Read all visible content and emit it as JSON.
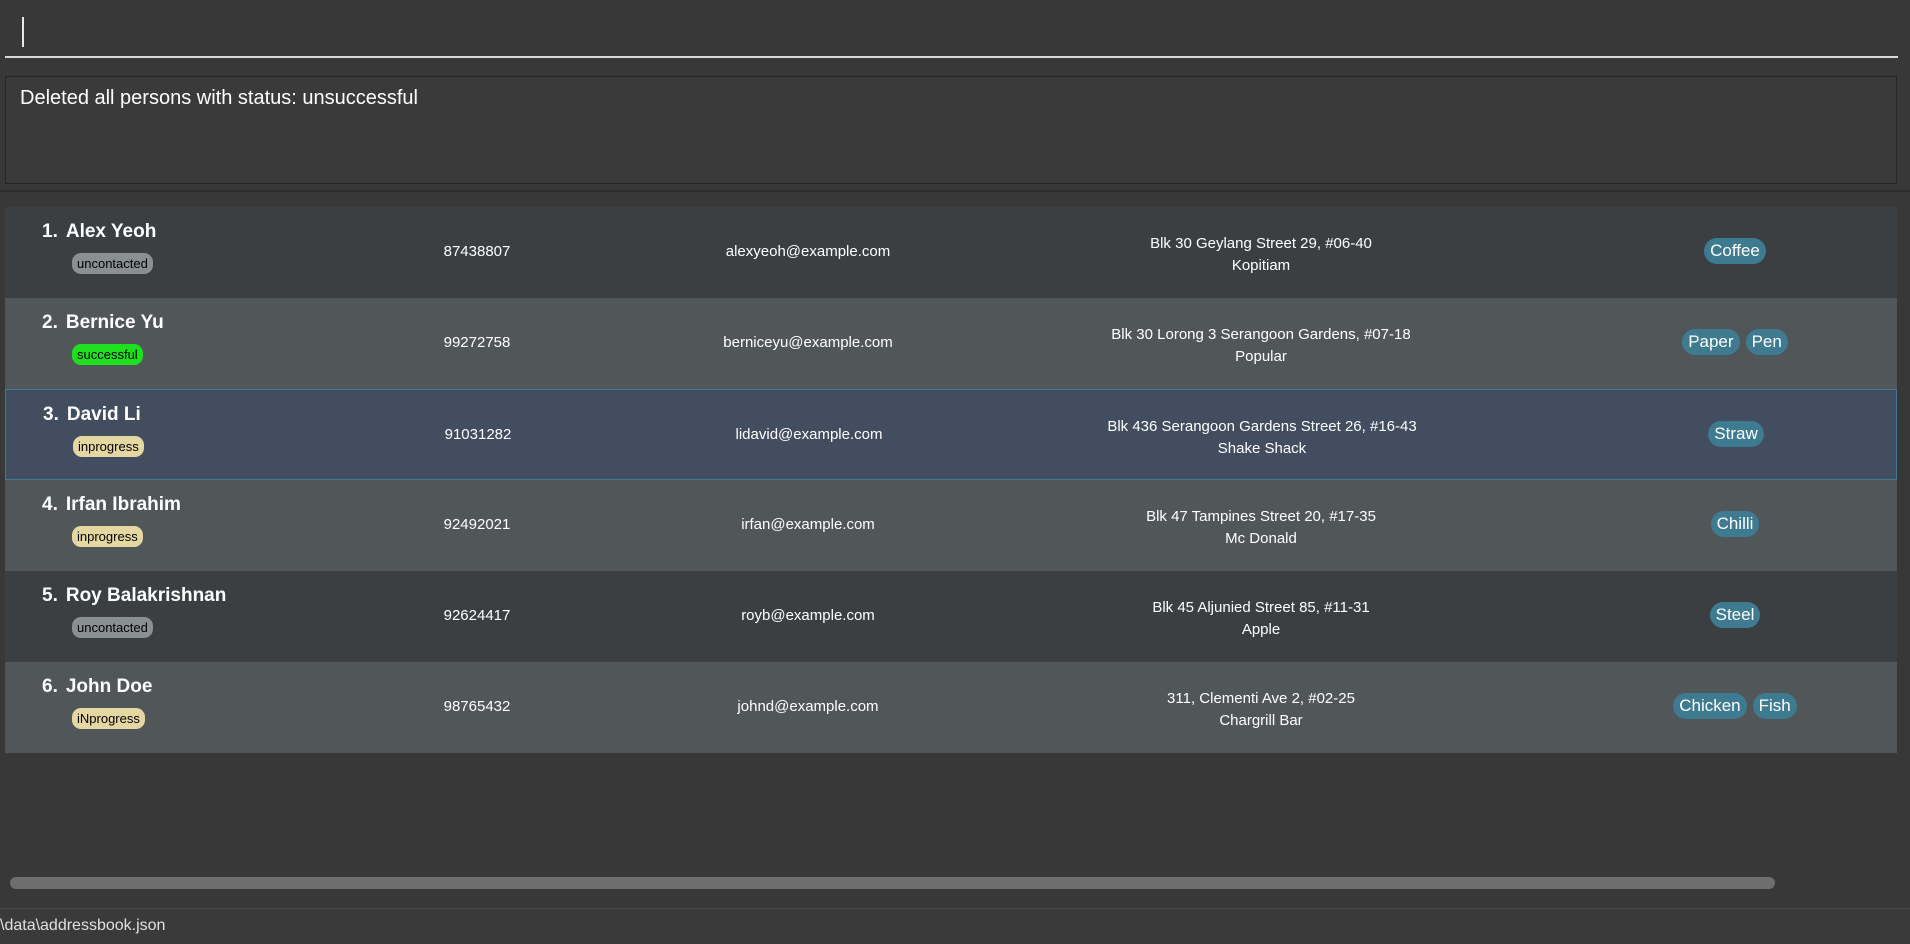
{
  "command": {
    "value": "",
    "placeholder": ""
  },
  "result": {
    "message": "Deleted all persons with status: unsuccessful"
  },
  "persons": [
    {
      "index": "1.",
      "name": "Alex Yeoh",
      "status": "uncontacted",
      "phone": "87438807",
      "email": "alexyeoh@example.com",
      "address_line1": "Blk 30 Geylang Street 29, #06-40",
      "address_line2": "Kopitiam",
      "tags": [
        "Coffee"
      ]
    },
    {
      "index": "2.",
      "name": "Bernice Yu",
      "status": "successful",
      "phone": "99272758",
      "email": "berniceyu@example.com",
      "address_line1": "Blk 30 Lorong 3 Serangoon Gardens, #07-18",
      "address_line2": "Popular",
      "tags": [
        "Paper",
        "Pen"
      ]
    },
    {
      "index": "3.",
      "name": "David Li",
      "status": "inprogress",
      "phone": "91031282",
      "email": "lidavid@example.com",
      "address_line1": "Blk 436 Serangoon Gardens Street 26, #16-43",
      "address_line2": "Shake Shack",
      "tags": [
        "Straw"
      ]
    },
    {
      "index": "4.",
      "name": "Irfan Ibrahim",
      "status": "inprogress",
      "phone": "92492021",
      "email": "irfan@example.com",
      "address_line1": "Blk 47 Tampines Street 20, #17-35",
      "address_line2": "Mc Donald",
      "tags": [
        "Chilli"
      ]
    },
    {
      "index": "5.",
      "name": "Roy Balakrishnan",
      "status": "uncontacted",
      "phone": "92624417",
      "email": "royb@example.com",
      "address_line1": "Blk 45 Aljunied Street 85, #11-31",
      "address_line2": "Apple",
      "tags": [
        "Steel"
      ]
    },
    {
      "index": "6.",
      "name": "John Doe",
      "status": "iNprogress",
      "phone": "98765432",
      "email": "johnd@example.com",
      "address_line1": "311, Clementi Ave 2, #02-25",
      "address_line2": "Chargrill Bar",
      "tags": [
        "Chicken",
        "Fish"
      ]
    }
  ],
  "selected_row": "3.",
  "status_bar": {
    "path": "\\data\\addressbook.json"
  },
  "colors": {
    "background": "#383838",
    "row_dark": "#3c3f41",
    "row_light": "#515658",
    "row_selected": "#424d5f",
    "tag": "#3e7b91",
    "status_uncontacted": "#8a8f91",
    "status_successful": "#1ee01e",
    "status_inprogress": "#e4d7a1"
  }
}
